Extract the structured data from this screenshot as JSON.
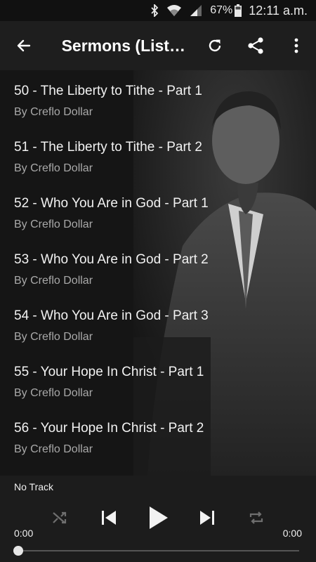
{
  "status_bar": {
    "battery": "67%",
    "time": "12:11 a.m."
  },
  "app_bar": {
    "title": "Sermons (List…",
    "icons": [
      "arrow-back-icon",
      "refresh-icon",
      "share-icon",
      "more-vert-icon"
    ]
  },
  "sermons": [
    {
      "title": "50 - The Liberty to Tithe - Part 1",
      "author": "By Creflo Dollar"
    },
    {
      "title": "51 - The Liberty to Tithe - Part 2",
      "author": "By Creflo Dollar"
    },
    {
      "title": "52 - Who You Are in God - Part 1",
      "author": "By Creflo Dollar"
    },
    {
      "title": "53 - Who You Are in God - Part 2",
      "author": "By Creflo Dollar"
    },
    {
      "title": "54 - Who You Are in God - Part 3",
      "author": "By Creflo Dollar"
    },
    {
      "title": "55 - Your Hope In Christ - Part 1",
      "author": "By Creflo Dollar"
    },
    {
      "title": "56 - Your Hope In Christ - Part 2",
      "author": "By Creflo Dollar"
    }
  ],
  "player": {
    "track": "No Track",
    "elapsed": "0:00",
    "duration": "0:00",
    "progress": 0,
    "controls": [
      "shuffle-icon",
      "skip-previous-icon",
      "play-icon",
      "skip-next-icon",
      "repeat-icon"
    ]
  },
  "colors": {
    "app_bar": "#1e1e1e",
    "status_bar": "#111111",
    "player_bar": "#1c1c1c",
    "title_text": "#f2f2f2",
    "subtitle_text": "#a9a9a9"
  }
}
